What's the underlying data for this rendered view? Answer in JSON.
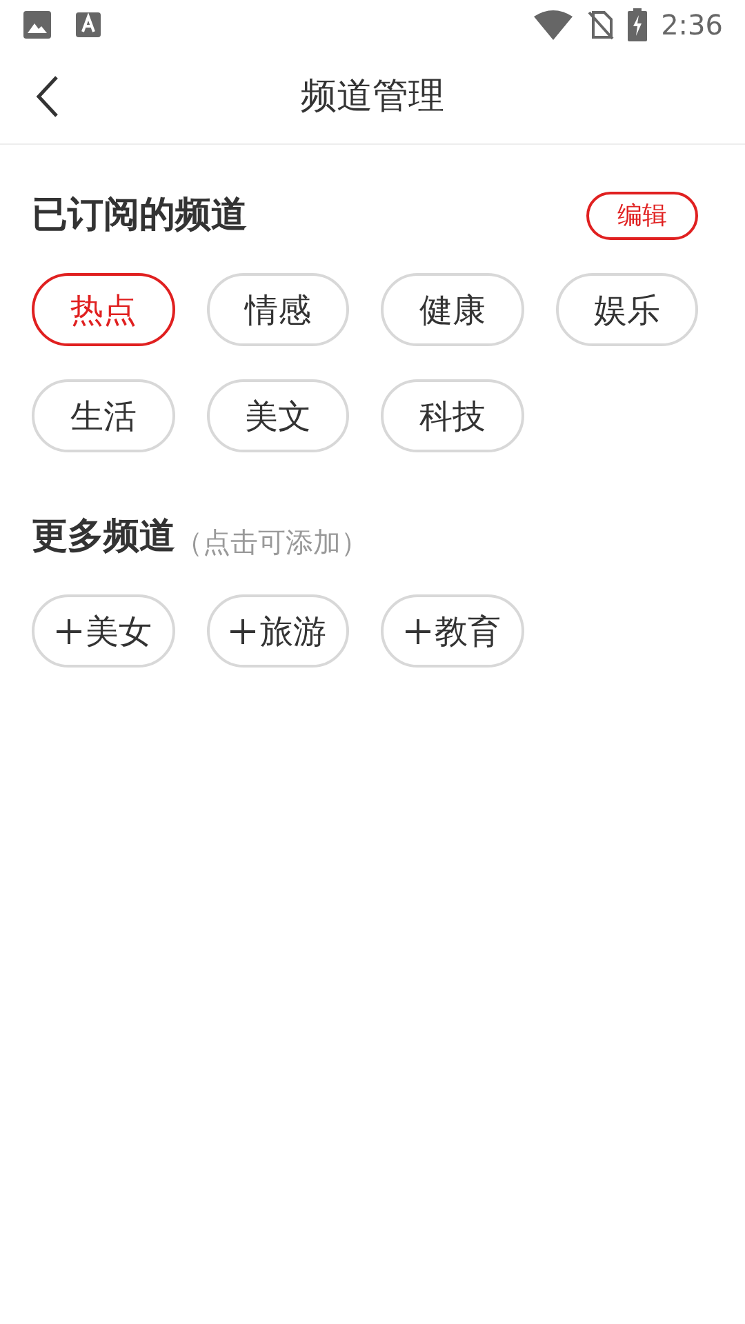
{
  "status_bar": {
    "time": "2:36"
  },
  "header": {
    "title": "频道管理"
  },
  "subscribed": {
    "title": "已订阅的频道",
    "edit_button": "编辑",
    "channels": [
      {
        "label": "热点",
        "selected": true
      },
      {
        "label": "情感",
        "selected": false
      },
      {
        "label": "健康",
        "selected": false
      },
      {
        "label": "娱乐",
        "selected": false
      },
      {
        "label": "生活",
        "selected": false
      },
      {
        "label": "美文",
        "selected": false
      },
      {
        "label": "科技",
        "selected": false
      }
    ]
  },
  "more": {
    "title": "更多频道",
    "hint": "（点击可添加）",
    "channels": [
      {
        "label": "美女"
      },
      {
        "label": "旅游"
      },
      {
        "label": "教育"
      }
    ]
  }
}
